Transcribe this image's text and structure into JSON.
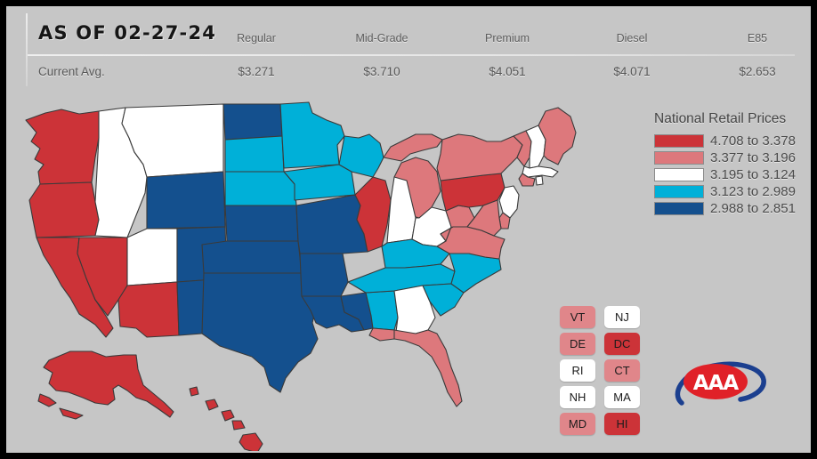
{
  "header": {
    "as_of_label": "AS OF 02-27-24",
    "row_label": "Current Avg.",
    "columns": [
      "Regular",
      "Mid-Grade",
      "Premium",
      "Diesel",
      "E85"
    ],
    "values": [
      "$3.271",
      "$3.710",
      "$4.051",
      "$4.071",
      "$2.653"
    ]
  },
  "legend": {
    "title": "National Retail Prices",
    "items": [
      {
        "label": "4.708 to 3.378",
        "color": "#cc3338"
      },
      {
        "label": "3.377 to 3.196",
        "color": "#dd787c"
      },
      {
        "label": "3.195 to 3.124",
        "color": "#ffffff"
      },
      {
        "label": "3.123 to 2.989",
        "color": "#00b0d8"
      },
      {
        "label": "2.988 to 2.851",
        "color": "#14508e"
      }
    ]
  },
  "state_boxes": [
    [
      {
        "label": "VT",
        "color": "#e0868a"
      },
      {
        "label": "NJ",
        "color": "#ffffff"
      }
    ],
    [
      {
        "label": "DE",
        "color": "#e0868a"
      },
      {
        "label": "DC",
        "color": "#cc3338"
      }
    ],
    [
      {
        "label": "RI",
        "color": "#ffffff"
      },
      {
        "label": "CT",
        "color": "#e0868a"
      }
    ],
    [
      {
        "label": "NH",
        "color": "#ffffff"
      },
      {
        "label": "MA",
        "color": "#ffffff"
      }
    ],
    [
      {
        "label": "MD",
        "color": "#e0868a"
      },
      {
        "label": "HI",
        "color": "#cc3338"
      }
    ]
  ],
  "logo": {
    "brand": "AAA",
    "oval_color": "#e02128",
    "swoosh_color": "#1b3f8f"
  },
  "chart_data": {
    "type": "map",
    "title": "National Retail Prices",
    "map_background": "#c6c6c6",
    "categories": [
      "4.708 to 3.378",
      "3.377 to 3.196",
      "3.195 to 3.124",
      "3.123 to 2.989",
      "2.988 to 2.851"
    ],
    "colors": [
      "#cc3338",
      "#dd787c",
      "#ffffff",
      "#00b0d8",
      "#14508e"
    ],
    "states": {
      "WA": "#cc3338",
      "OR": "#cc3338",
      "CA": "#cc3338",
      "NV": "#cc3338",
      "ID": "#ffffff",
      "MT": "#ffffff",
      "UT": "#ffffff",
      "AZ": "#cc3338",
      "WY": "#14508e",
      "CO": "#14508e",
      "NM": "#14508e",
      "ND": "#14508e",
      "SD": "#00b0d8",
      "NE": "#00b0d8",
      "MN": "#00b0d8",
      "IA": "#00b0d8",
      "WI": "#00b0d8",
      "KS": "#14508e",
      "MO": "#14508e",
      "OK": "#14508e",
      "TX": "#14508e",
      "AR": "#14508e",
      "LA": "#14508e",
      "MS": "#14508e",
      "AL": "#00b0d8",
      "TN": "#00b0d8",
      "KY": "#00b0d8",
      "IL": "#cc3338",
      "IN": "#ffffff",
      "OH": "#ffffff",
      "MI": "#dd787c",
      "GA": "#ffffff",
      "FL": "#dd787c",
      "SC": "#00b0d8",
      "NC": "#00b0d8",
      "VA": "#dd787c",
      "WV": "#dd787c",
      "PA": "#cc3338",
      "NY": "#dd787c",
      "ME": "#dd787c",
      "VT": "#dd787c",
      "NH": "#ffffff",
      "MA": "#ffffff",
      "NJ": "#ffffff",
      "MD": "#dd787c",
      "DE": "#dd787c",
      "DC": "#cc3338",
      "CT": "#dd787c",
      "RI": "#ffffff",
      "AK": "#cc3338",
      "HI": "#cc3338"
    }
  }
}
